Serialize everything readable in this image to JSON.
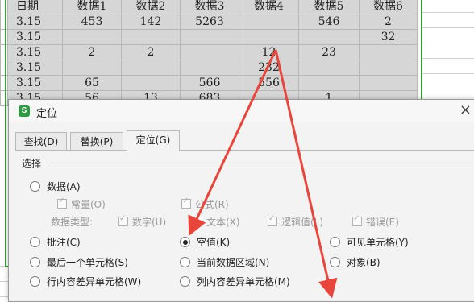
{
  "sheet": {
    "header": [
      "日期",
      "数据1",
      "数据2",
      "数据3",
      "数据4",
      "数据5",
      "数据6"
    ],
    "rows": [
      [
        "3.15",
        "453",
        "142",
        "5263",
        "",
        "546",
        "2"
      ],
      [
        "3.15",
        "",
        "",
        "",
        "",
        "",
        "32"
      ],
      [
        "3.15",
        "2",
        "2",
        "",
        "12",
        "23",
        ""
      ],
      [
        "3.15",
        "",
        "",
        "",
        "232",
        "",
        ""
      ],
      [
        "3.15",
        "65",
        "",
        "566",
        "556",
        "",
        ""
      ],
      [
        "3.15",
        "56",
        "13",
        "683",
        "",
        "1",
        ""
      ]
    ]
  },
  "dialog": {
    "icon_letter": "S",
    "title": "定位",
    "close": "×",
    "tabs": [
      "查找(D)",
      "替换(P)",
      "定位(G)"
    ],
    "group_label": "选择",
    "options": {
      "data": "数据(A)",
      "constant": "常量(O)",
      "formula": "公式(R)",
      "data_type_label": "数据类型:",
      "number": "数字(U)",
      "text": "文本(X)",
      "logical": "逻辑值(L)",
      "error": "错误(E)",
      "comment": "批注(C)",
      "blank": "空值(K)",
      "visible": "可见单元格(Y)",
      "last_cell": "最后一个单元格(S)",
      "current_region": "当前数据区域(N)",
      "object": "对象(B)",
      "row_diff": "行内容差异单元格(W)",
      "col_diff": "列内容差异单元格(M)"
    },
    "selected_option": "blank"
  },
  "colors": {
    "selection_border": "#3a9a3a",
    "arrow": "#e8463c",
    "icon_bg": "#2e9b42"
  }
}
